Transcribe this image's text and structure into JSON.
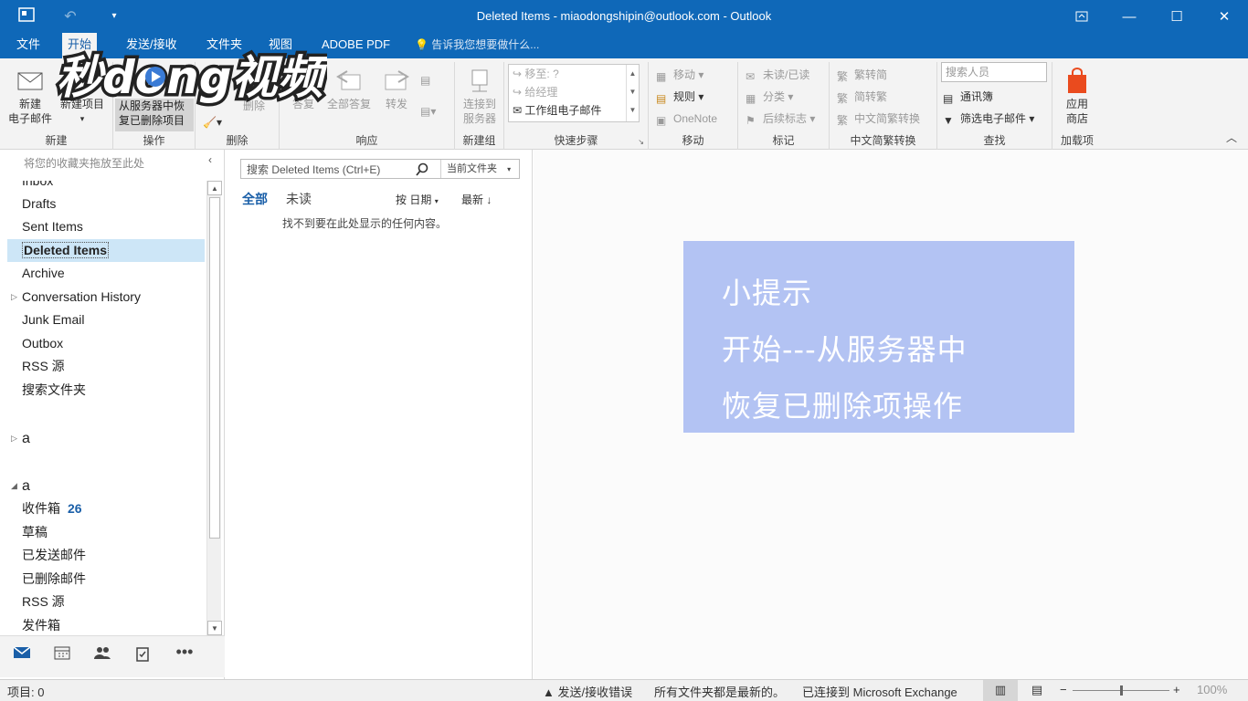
{
  "titlebar": {
    "title": "Deleted Items - miaodongshipin@outlook.com - Outlook",
    "qat_icons": [
      "outlook-logo-icon",
      "undo-icon",
      "customize-qat-icon"
    ],
    "controls": [
      "restore-ribbon-icon",
      "minimize-icon",
      "maximize-icon",
      "close-icon"
    ]
  },
  "tabs": {
    "file": "文件",
    "home": "开始",
    "send_receive": "发送/接收",
    "folder": "文件夹",
    "view": "视图",
    "adobe": "ADOBE PDF",
    "tell_me": "告诉我您想要做什么..."
  },
  "ribbon": {
    "new": {
      "label": "新建",
      "new_email_l1": "新建",
      "new_email_l2": "电子邮件",
      "new_items": "新建项目"
    },
    "actions": {
      "label": "操作",
      "recover_l1": "从服务器中恢",
      "recover_l2": "复已删除项目"
    },
    "delete": {
      "label": "删除",
      "delete_btn": "删除"
    },
    "respond": {
      "label": "响应",
      "reply": "答复",
      "reply_all": "全部答复",
      "forward": "转发"
    },
    "new_group": {
      "label": "新建组",
      "connect_l1": "连接到",
      "connect_l2": "服务器"
    },
    "quick_steps": {
      "label": "快速步骤",
      "move_to": "移至: ?",
      "to_manager": "给经理",
      "team_email": "工作组电子邮件"
    },
    "move": {
      "label": "移动",
      "move": "移动",
      "rules": "规则",
      "onenote": "OneNote"
    },
    "tags": {
      "label": "标记",
      "unread_read": "未读/已读",
      "categorize": "分类",
      "follow_up": "后续标志"
    },
    "chinese_conv": {
      "label": "中文简繁转换",
      "to_simplified": "繁转简",
      "to_traditional": "简转繁",
      "convert": "中文简繁转换"
    },
    "find": {
      "label": "查找",
      "search_people_placeholder": "搜索人员",
      "address_book": "通讯簿",
      "filter_email": "筛选电子邮件"
    },
    "addins": {
      "label": "加载项",
      "store_l1": "应用",
      "store_l2": "商店"
    }
  },
  "watermark": {
    "text": "秒dong视频"
  },
  "folder_pane": {
    "fav_hint": "将您的收藏夹拖放至此处",
    "items": [
      {
        "label": "Inbox"
      },
      {
        "label": "Drafts"
      },
      {
        "label": "Sent Items"
      },
      {
        "label": "Deleted Items"
      },
      {
        "label": "Archive"
      },
      {
        "label": "Conversation History"
      },
      {
        "label": "Junk Email"
      },
      {
        "label": "Outbox"
      },
      {
        "label": "RSS 源"
      },
      {
        "label": "搜索文件夹"
      }
    ],
    "account1": "a",
    "account2": "a",
    "account2_items": [
      {
        "label": "收件箱",
        "count": "26"
      },
      {
        "label": "草稿"
      },
      {
        "label": "已发送邮件"
      },
      {
        "label": "已删除邮件"
      },
      {
        "label": "RSS 源"
      },
      {
        "label": "发件箱"
      }
    ]
  },
  "message_list": {
    "search_placeholder": "搜索 Deleted Items (Ctrl+E)",
    "scope": "当前文件夹",
    "filter_all": "全部",
    "filter_unread": "未读",
    "sort_by": "按 日期",
    "sort_order": "最新",
    "empty": "找不到要在此处显示的任何内容。"
  },
  "tip": {
    "line1": "小提示",
    "line2": "开始---从服务器中",
    "line3": "恢复已删除项操作"
  },
  "statusbar": {
    "items": "项目: 0",
    "send_error": "发送/接收错误",
    "up_to_date": "所有文件夹都是最新的。",
    "connected": "已连接到 Microsoft Exchange",
    "zoom": "100%"
  },
  "colors": {
    "brand": "#0f68b8",
    "selected_folder": "#cde6f7",
    "tip_bg": "#b3c3f3",
    "accent_count": "#1a5fa8"
  }
}
